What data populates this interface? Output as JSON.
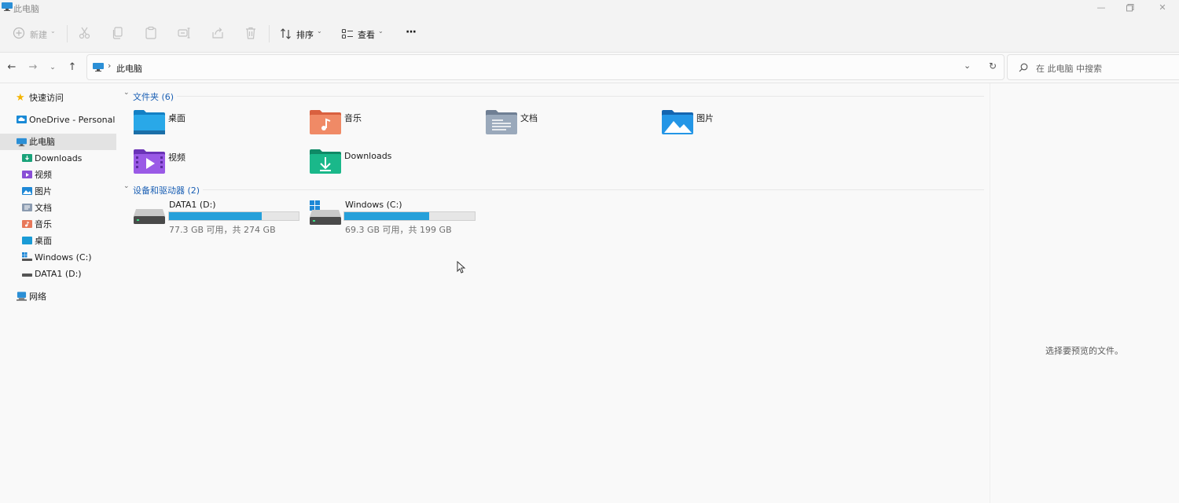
{
  "window": {
    "title": "此电脑"
  },
  "toolbar": {
    "new_label": "新建",
    "sort_label": "排序",
    "view_label": "查看",
    "more_label": "···"
  },
  "address": {
    "breadcrumb": "此电脑",
    "search_placeholder": "在 此电脑 中搜索"
  },
  "sidebar": {
    "quick_access": "快速访问",
    "onedrive": "OneDrive - Personal",
    "this_pc": "此电脑",
    "children": [
      "Downloads",
      "视频",
      "图片",
      "文档",
      "音乐",
      "桌面",
      "Windows (C:)",
      "DATA1 (D:)"
    ],
    "network": "网络"
  },
  "folders": {
    "header": "文件夹 (6)",
    "items": [
      "桌面",
      "音乐",
      "文档",
      "图片",
      "视频",
      "Downloads"
    ]
  },
  "drives": {
    "header": "设备和驱动器 (2)",
    "items": [
      {
        "name": "DATA1 (D:)",
        "info": "77.3 GB 可用，共 274 GB",
        "used_fraction": 0.718
      },
      {
        "name": "Windows (C:)",
        "info": "69.3 GB 可用，共 199 GB",
        "used_fraction": 0.652
      }
    ]
  },
  "preview": {
    "message": "选择要预览的文件。"
  },
  "colors": {
    "accent": "#1a5fb4",
    "bar_fill": "#26a0da",
    "selection": "#e3e3e3"
  }
}
